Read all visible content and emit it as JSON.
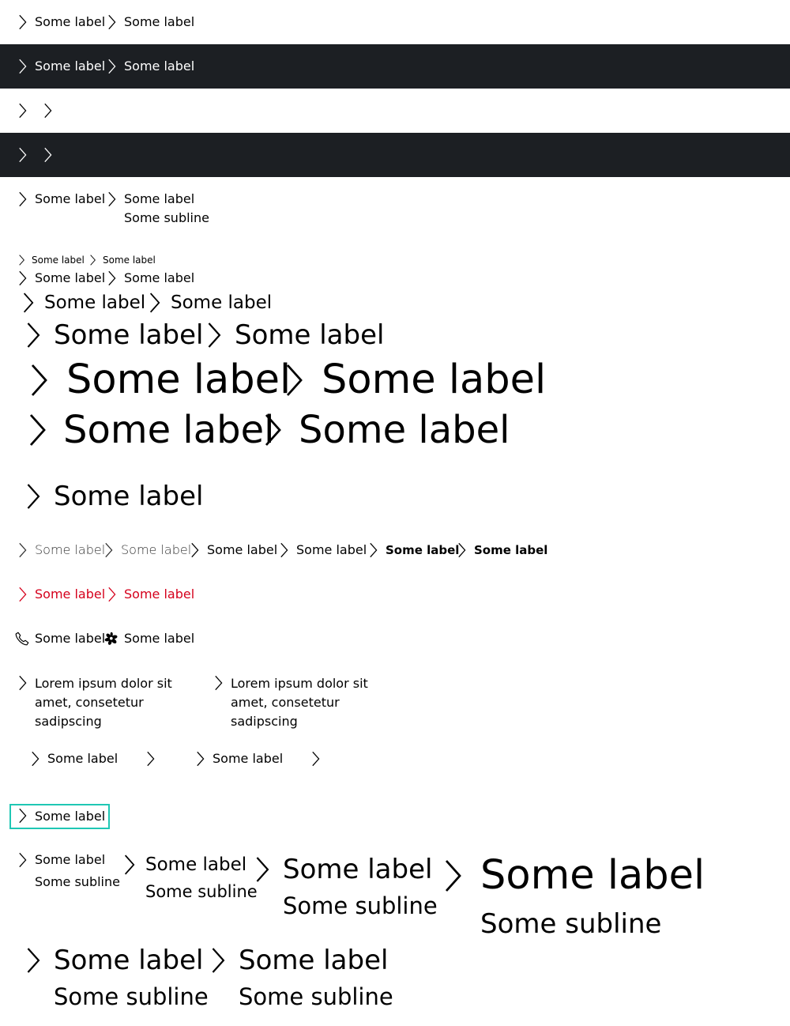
{
  "label": "Some label",
  "subline": "Some subline",
  "lorem": "Lorem ipsum dolor sit amet, consetetur sadipscing",
  "accent": "#d5001c",
  "dark_bg": "#1c1f23",
  "focus_color": "#1fc7b4",
  "icons": {
    "default": "arrow-head-right-icon",
    "alt1": "phone-icon",
    "alt2": "flower-icon"
  }
}
